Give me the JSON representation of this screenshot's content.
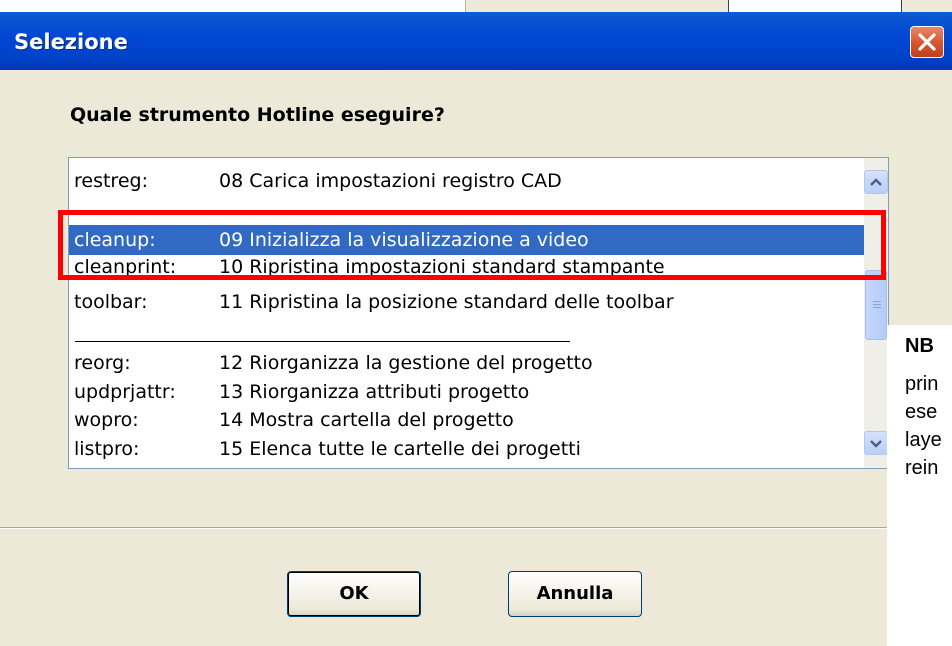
{
  "dialog": {
    "title": "Selezione",
    "prompt": "Quale strumento Hotline eseguire?"
  },
  "list": {
    "items": [
      {
        "cmd": "restreg:",
        "desc": "08 Carica impostazioni registro CAD"
      },
      {
        "cmd": "cleanup:",
        "desc": "09 Inizializza la visualizzazione a video",
        "selected": true
      },
      {
        "cmd": "cleanprint:",
        "desc": "10 Ripristina impostazioni standard stampante"
      },
      {
        "cmd": "toolbar:",
        "desc": "11 Ripristina la posizione standard delle toolbar"
      },
      {
        "cmd": "reorg:",
        "desc": "12 Riorganizza la gestione del progetto"
      },
      {
        "cmd": "updprjattr:",
        "desc": "13 Riorganizza attributi progetto"
      },
      {
        "cmd": "wopro:",
        "desc": "14 Mostra cartella del progetto"
      },
      {
        "cmd": "listpro:",
        "desc": "15 Elenca tutte le cartelle dei progetti"
      }
    ]
  },
  "buttons": {
    "ok": "OK",
    "cancel": "Annulla"
  },
  "side_note": {
    "lines": [
      "NB",
      "prin",
      "ese",
      "laye",
      "rein"
    ]
  },
  "colors": {
    "titlebar": "#0046d5",
    "selection": "#316ac5",
    "highlight": "#ff0000",
    "dialog_bg": "#ece9d8"
  },
  "icons": [
    "close-icon",
    "scroll-up-icon",
    "scroll-down-icon"
  ]
}
